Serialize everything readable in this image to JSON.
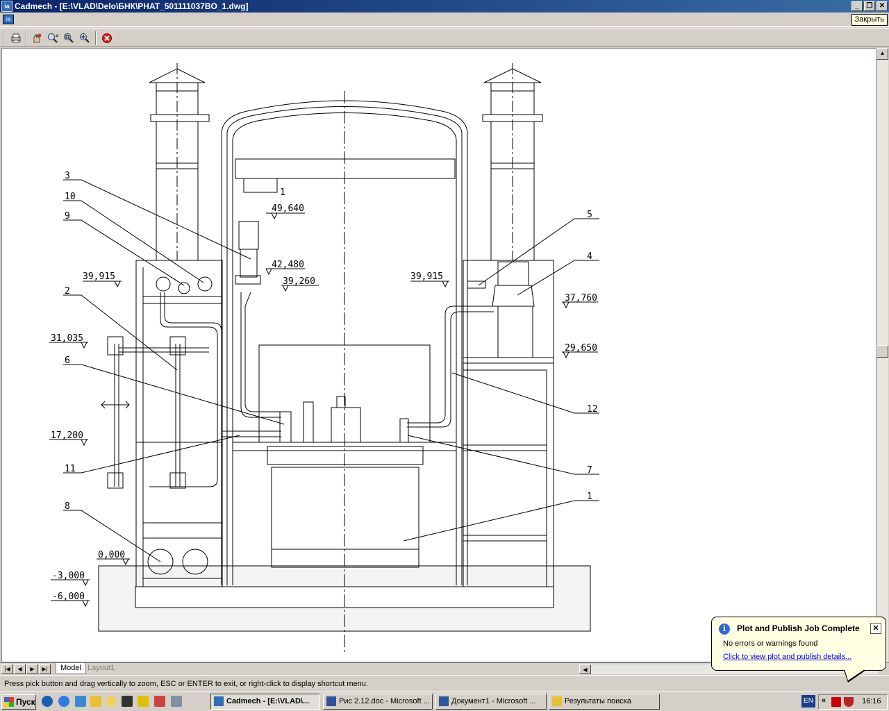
{
  "window": {
    "title": "Cadmech - [E:\\VLAD\\Delo\\БНК\\PHAT_501111037BO_1.dwg]",
    "close_label": "Закрыть",
    "app_icon": "cadmech-icon"
  },
  "toolbar": {
    "buttons": [
      {
        "name": "print-icon"
      },
      {
        "name": "pan-icon"
      },
      {
        "name": "zoom-realtime-icon"
      },
      {
        "name": "zoom-window-icon"
      },
      {
        "name": "zoom-extents-icon"
      },
      {
        "name": "close-preview-icon"
      }
    ]
  },
  "drawing": {
    "callouts": [
      "3",
      "10",
      "9",
      "2",
      "6",
      "11",
      "8",
      "5",
      "4",
      "12",
      "7",
      "1"
    ],
    "elevations": {
      "e49640": "49,640",
      "e42480": "42,480",
      "e39260": "39,260",
      "e39915_left": "39,915",
      "e39915_right": "39,915",
      "e37760": "37,760",
      "e29650": "29,650",
      "e31035": "31,035",
      "e17200": "17,200",
      "e0000": "0,000",
      "em3000": "-3,000",
      "em6000": "-6,000"
    },
    "small_label": "1"
  },
  "tabs": {
    "model": "Model",
    "layout1": "Layout1"
  },
  "status": {
    "text": "Press pick button and drag vertically to zoom, ESC or ENTER to exit, or right-click to display shortcut menu."
  },
  "notification": {
    "title": "Plot and Publish Job Complete",
    "message": "No errors or warnings found",
    "link": "Click to view plot and publish details..."
  },
  "taskbar": {
    "start": "Пуск",
    "tasks": [
      {
        "label": "Cadmech - [E:\\VLAD\\...",
        "active": true
      },
      {
        "label": "Рис 2.12.doc - Microsoft ...",
        "active": false
      },
      {
        "label": "Документ1 - Microsoft ...",
        "active": false
      },
      {
        "label": "Результаты поиска",
        "active": false
      }
    ],
    "lang": "EN",
    "clock": "16:16"
  }
}
